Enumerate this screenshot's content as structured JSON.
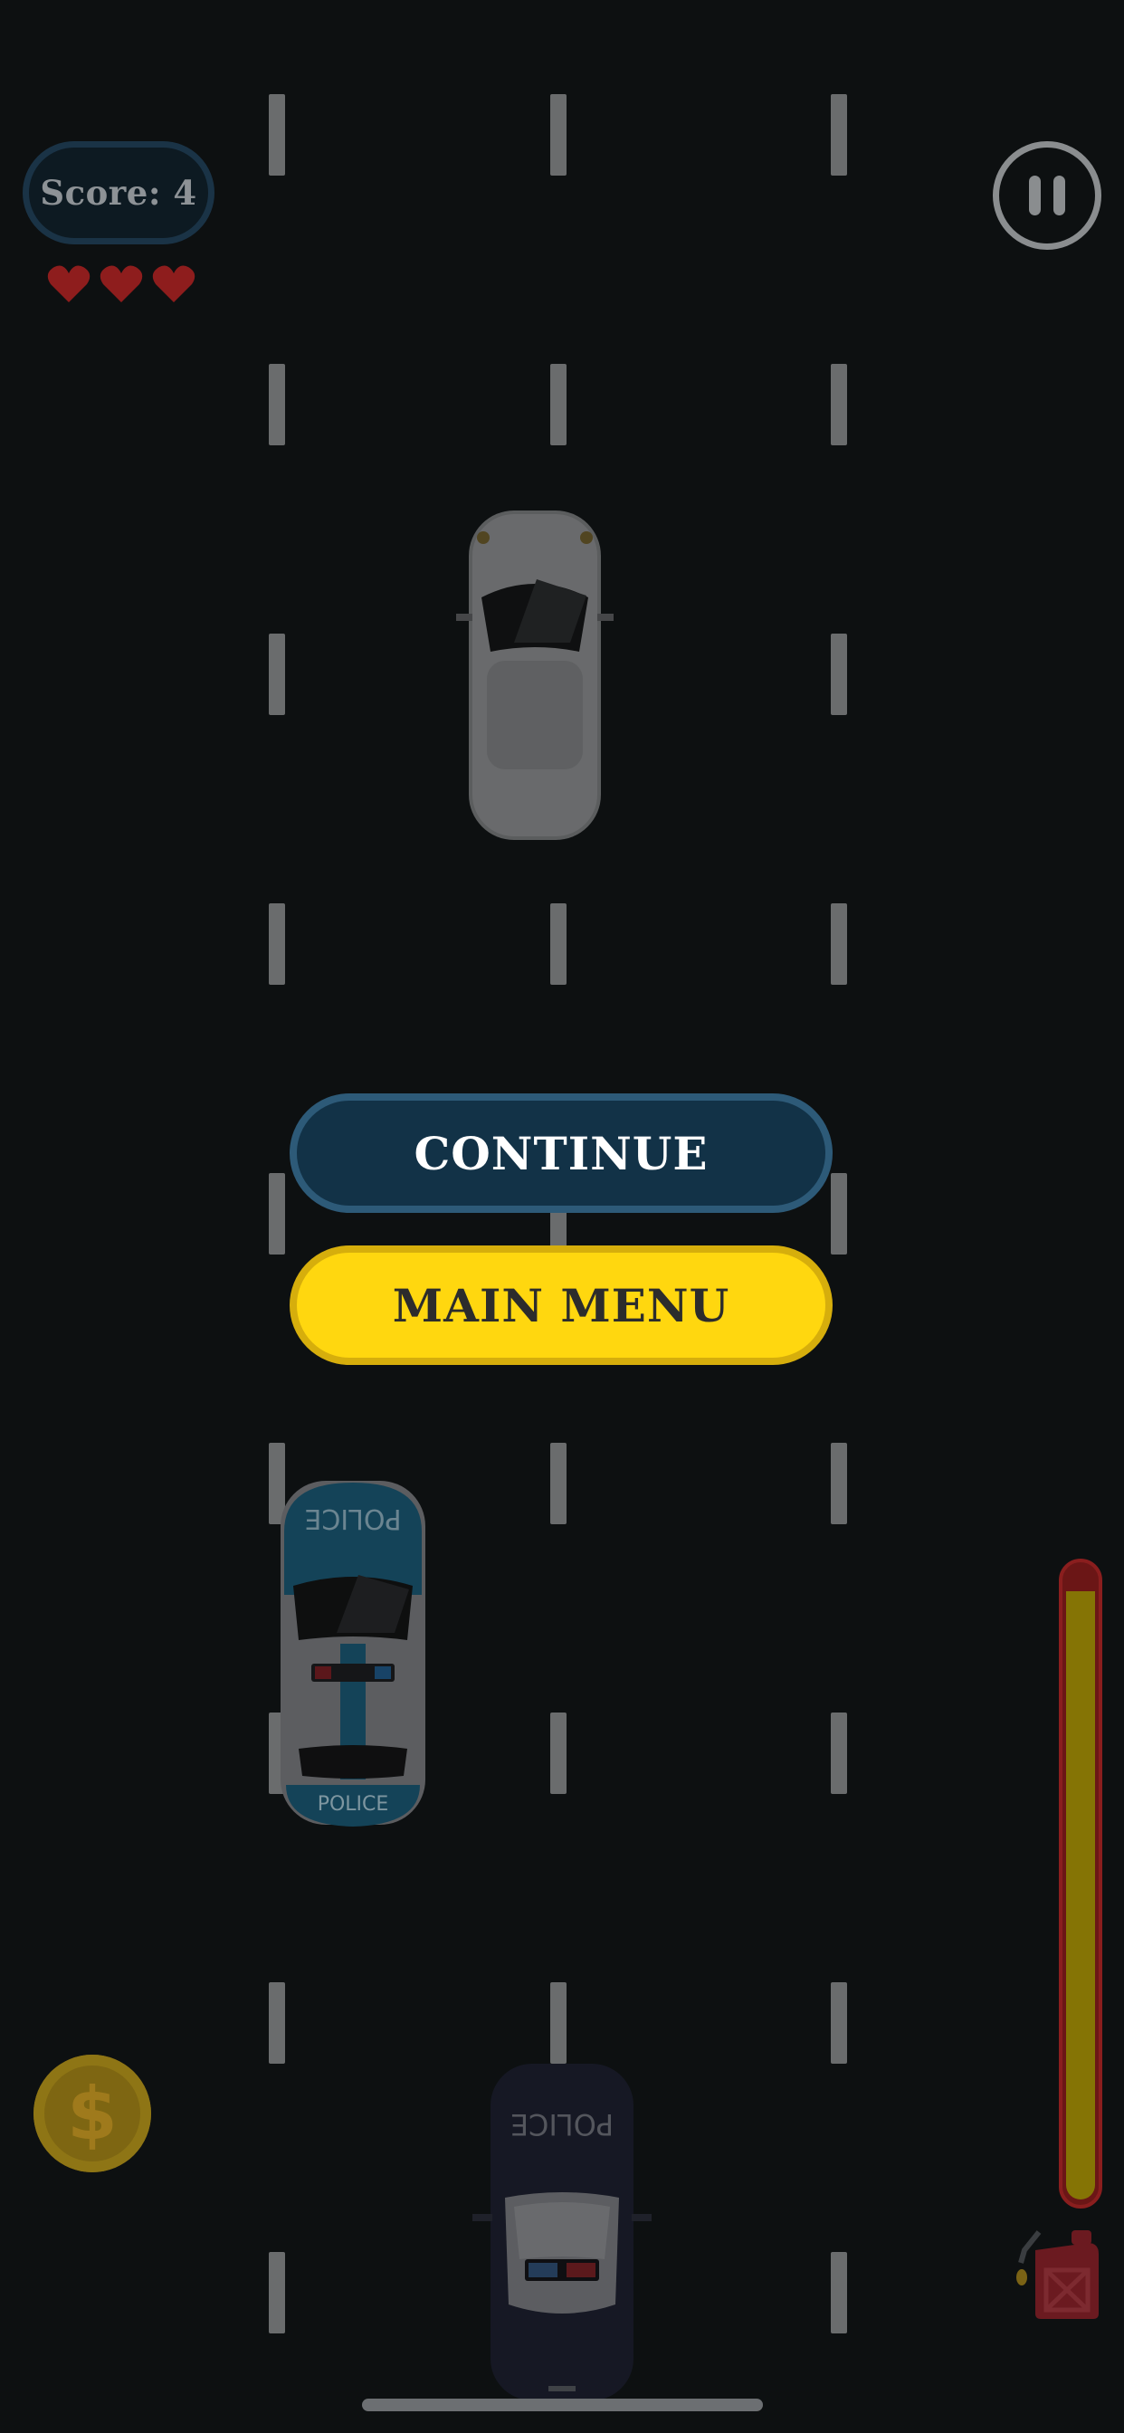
{
  "hud": {
    "score_label": "Score: 4",
    "lives": 3,
    "pause_icon": "pause-icon"
  },
  "menu": {
    "continue_label": "CONTINUE",
    "main_menu_label": "MAIN MENU"
  },
  "powerups": {
    "coin_symbol": "$",
    "fuel_level": 0.96
  },
  "cars": [
    {
      "type": "white-sedan",
      "lane": 2
    },
    {
      "type": "police-blue",
      "lane": 1,
      "roof_text": "POLICE",
      "rear_text": "POLICE"
    },
    {
      "type": "police-dark-player",
      "lane": 2,
      "roof_text": "POLICE"
    }
  ],
  "colors": {
    "heart": "#8e1d1d",
    "continue_button": "#123247",
    "main_menu_button": "#ffd70f",
    "fuel_fill": "#857405",
    "fuel_empty": "#6b1616"
  }
}
